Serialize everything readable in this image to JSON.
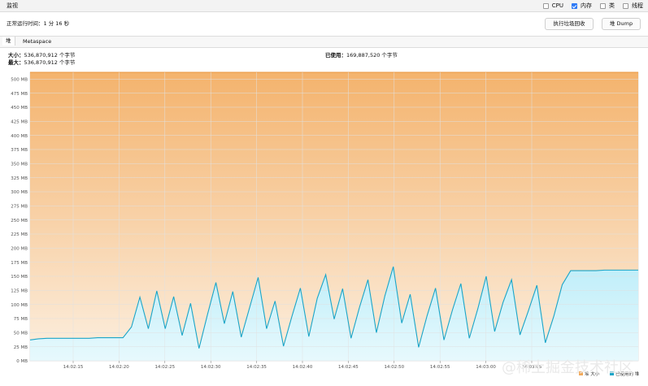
{
  "header": {
    "title": "监视",
    "checks": [
      {
        "label": "CPU",
        "checked": false
      },
      {
        "label": "内存",
        "checked": true
      },
      {
        "label": "类",
        "checked": false
      },
      {
        "label": "线程",
        "checked": false
      }
    ]
  },
  "uptime": "正常运行时间：1 分 16 秒",
  "buttons": {
    "gc": "执行垃圾回收",
    "dump": "堆 Dump"
  },
  "tabs": {
    "heap": "堆",
    "metaspace": "Metaspace"
  },
  "stats": {
    "size_label": "大小：",
    "size_value": "536,870,912 个字节",
    "max_label": "最大：",
    "max_value": "536,870,912 个字节",
    "used_label": "已使用：",
    "used_value": "169,887,520 个字节"
  },
  "chart_data": {
    "type": "area",
    "y_ticks": [
      "0 MB",
      "25 MB",
      "50 MB",
      "75 MB",
      "100 MB",
      "125 MB",
      "150 MB",
      "175 MB",
      "200 MB",
      "225 MB",
      "250 MB",
      "275 MB",
      "300 MB",
      "325 MB",
      "350 MB",
      "375 MB",
      "400 MB",
      "425 MB",
      "450 MB",
      "475 MB",
      "500 MB"
    ],
    "x_ticks": [
      "14:02:15",
      "14:02:20",
      "14:02:25",
      "14:02:30",
      "14:02:35",
      "14:02:40",
      "14:02:45",
      "14:02:50",
      "14:02:55",
      "14:03:00",
      "14:03:05"
    ],
    "ylim": [
      0,
      512
    ],
    "series": [
      {
        "name": "堆 大小",
        "color": "#f1a95a",
        "values": [
          512,
          512,
          512,
          512,
          512,
          512,
          512,
          512,
          512,
          512,
          512,
          512,
          512,
          512,
          512,
          512,
          512,
          512,
          512,
          512,
          512,
          512,
          512,
          512,
          512,
          512,
          512,
          512,
          512,
          512,
          512,
          512,
          512,
          512,
          512,
          512,
          512,
          512,
          512,
          512,
          512,
          512,
          512,
          512,
          512,
          512,
          512,
          512,
          512,
          512,
          512,
          512,
          512,
          512,
          512,
          512,
          512,
          512,
          512,
          512,
          512,
          512,
          512,
          512,
          512,
          512,
          512,
          512,
          512,
          512,
          512,
          512,
          512
        ]
      },
      {
        "name": "已使用的 堆",
        "color": "#1aa5c8",
        "values": [
          37,
          39,
          40,
          40,
          40,
          40,
          40,
          40,
          41,
          41,
          41,
          41,
          60,
          113,
          57,
          124,
          57,
          114,
          45,
          102,
          22,
          82,
          139,
          66,
          123,
          42,
          95,
          148,
          57,
          106,
          26,
          79,
          129,
          43,
          111,
          153,
          74,
          128,
          40,
          95,
          144,
          50,
          115,
          167,
          67,
          118,
          24,
          80,
          129,
          37,
          90,
          137,
          40,
          92,
          150,
          52,
          104,
          144,
          46,
          89,
          134,
          32,
          79,
          135,
          160,
          160,
          160,
          160,
          161,
          161,
          161,
          161,
          161
        ]
      }
    ]
  },
  "legend": {
    "items": [
      "堆 大小",
      "已使用的 堆"
    ]
  },
  "watermark": "@稀土掘金技术社区"
}
